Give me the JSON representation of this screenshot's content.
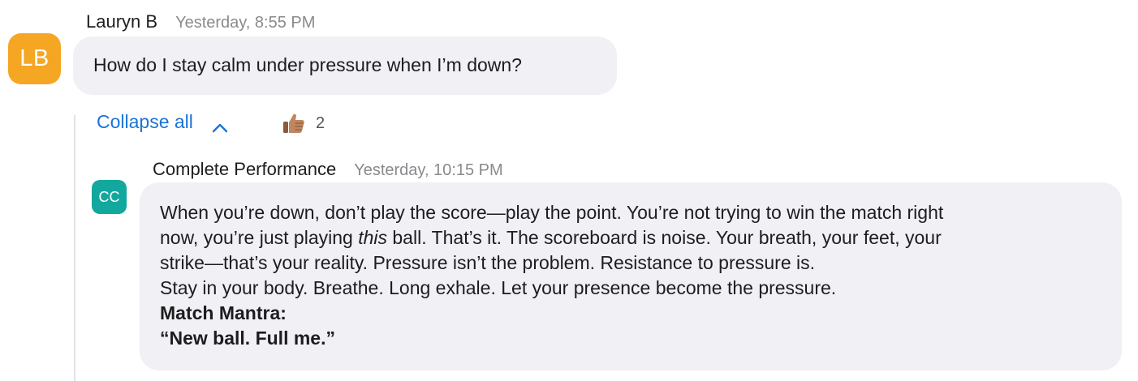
{
  "message": {
    "avatar_initials": "LB",
    "avatar_color": "#f5a623",
    "sender": "Lauryn B",
    "time": "Yesterday, 8:55 PM",
    "text": "How do I stay calm under pressure when I’m down?"
  },
  "thread": {
    "collapse_label": "Collapse all",
    "collapse_icon": "chevron-up-icon",
    "reaction": {
      "icon": "thumbs-up-icon",
      "count": "2"
    }
  },
  "reply": {
    "avatar_initials": "CC",
    "avatar_color": "#13a89e",
    "sender": "Complete Performance",
    "time": "Yesterday, 10:15 PM",
    "line1": "When you’re down, don’t play the score—play the point. You’re not trying to win the match right",
    "line2_before": "now, you’re just playing ",
    "line2_italic": "this",
    "line2_after": " ball. That’s it. The scoreboard is noise. Your breath, your feet, your",
    "line3": "strike—that’s your reality. Pressure isn’t the problem. Resistance to pressure is.",
    "line4": "Stay in your body. Breathe. Long exhale. Let your presence become the pressure.",
    "mantra_heading": "Match Mantra:",
    "mantra_text": "“New ball. Full me.”"
  },
  "colors": {
    "bubble_bg": "#f0f0f5",
    "link_blue": "#1a73d8",
    "timestamp_gray": "#8a8a8e"
  }
}
